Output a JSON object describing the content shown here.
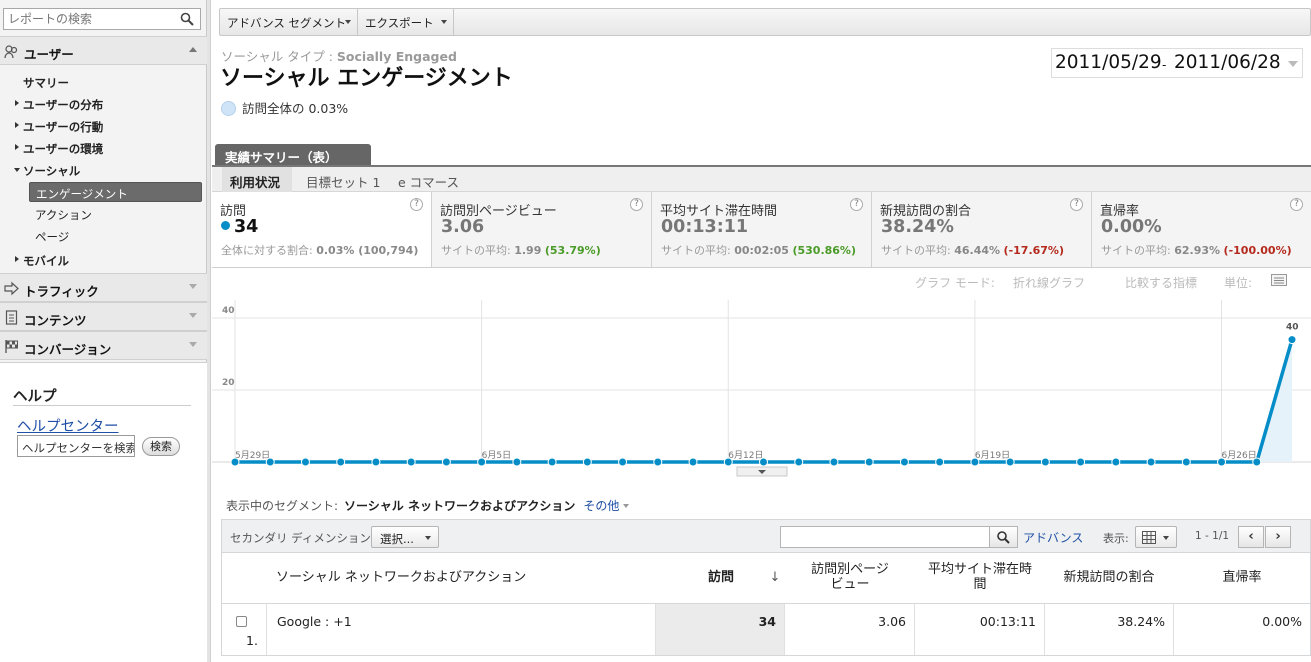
{
  "sidebar": {
    "search_placeholder": "レポートの検索",
    "sections": {
      "users": "ユーザー",
      "traffic": "トラフィック",
      "content": "コンテンツ",
      "conversion": "コンバージョン"
    },
    "items": {
      "summary": "サマリー",
      "distribution": "ユーザーの分布",
      "behavior": "ユーザーの行動",
      "environment": "ユーザーの環境",
      "social": "ソーシャル",
      "engagement": "エンゲージメント",
      "action": "アクション",
      "page": "ページ",
      "mobile": "モバイル"
    },
    "help": {
      "title": "ヘルプ",
      "center_link": "ヘルプセンター",
      "search_input": "ヘルプセンターを検索",
      "search_button": "検索"
    }
  },
  "toolbar": {
    "advanced_segments": "アドバンス セグメント",
    "export": "エクスポート"
  },
  "header": {
    "subtitle_prefix": "ソーシャル タイプ :",
    "subtitle_value": "Socially Engaged",
    "title": "ソーシャル エンゲージメント",
    "percent_text": "訪問全体の 0.03%",
    "date_start": "2011/05/29",
    "date_sep": "-",
    "date_end": "2011/06/28"
  },
  "tabs": {
    "view": "実績サマリー（表）",
    "usage": "利用状況",
    "goal": "目標セット 1",
    "ecommerce": "e コマース"
  },
  "metrics": [
    {
      "name": "訪問",
      "value": "34",
      "avg_label": "全体に対する割合:",
      "avg_value": "0.03% (100,794)",
      "delta": ""
    },
    {
      "name": "訪問別ページビュー",
      "value": "3.06",
      "avg_label": "サイトの平均:",
      "avg_value": "1.99",
      "delta": "(53.79%)"
    },
    {
      "name": "平均サイト滞在時間",
      "value": "00:13:11",
      "avg_label": "サイトの平均:",
      "avg_value": "00:02:05",
      "delta": "(530.86%)"
    },
    {
      "name": "新規訪問の割合",
      "value": "38.24%",
      "avg_label": "サイトの平均:",
      "avg_value": "46.44%",
      "delta": "(-17.67%)"
    },
    {
      "name": "直帰率",
      "value": "0.00%",
      "avg_label": "サイトの平均:",
      "avg_value": "62.93%",
      "delta": "(-100.00%)"
    }
  ],
  "graph_options": {
    "mode_label": "グラフ モード:",
    "mode_value": "折れ線グラフ",
    "compare": "比較する指標",
    "unit": "単位:"
  },
  "chart_data": {
    "type": "line",
    "x": [
      "5月29日",
      "5月30日",
      "5月31日",
      "6月1日",
      "6月2日",
      "6月3日",
      "6月4日",
      "6月5日",
      "6月6日",
      "6月7日",
      "6月8日",
      "6月9日",
      "6月10日",
      "6月11日",
      "6月12日",
      "6月13日",
      "6月14日",
      "6月15日",
      "6月16日",
      "6月17日",
      "6月18日",
      "6月19日",
      "6月20日",
      "6月21日",
      "6月22日",
      "6月23日",
      "6月24日",
      "6月25日",
      "6月26日",
      "6月27日",
      "6月28日"
    ],
    "x_tick_labels": [
      "5月29日",
      "6月5日",
      "6月12日",
      "6月19日",
      "6月26日"
    ],
    "series": [
      {
        "values": [
          0,
          0,
          0,
          0,
          0,
          0,
          0,
          0,
          0,
          0,
          0,
          0,
          0,
          0,
          0,
          0,
          0,
          0,
          0,
          0,
          0,
          0,
          0,
          0,
          0,
          0,
          0,
          0,
          0,
          0,
          34
        ]
      }
    ],
    "y_ticks": [
      "40",
      "20"
    ],
    "ylim": [
      0,
      40
    ],
    "end_label": "40",
    "grid": true,
    "line_color": "#058dc7"
  },
  "segment": {
    "label": "表示中のセグメント:",
    "value": "ソーシャル ネットワークおよびアクション",
    "other": "その他"
  },
  "table_tools": {
    "secondary_label": "セカンダリ ディメンション:",
    "select_label": "選択...",
    "advanced": "アドバンス",
    "show_label": "表示:",
    "pager": "1 - 1/1",
    "prev": "‹",
    "next": "›"
  },
  "table": {
    "headers": {
      "dimension": "ソーシャル ネットワークおよびアクション",
      "visits": "訪問",
      "sort_icon": "↓",
      "pageviews_1": "訪問別ページ",
      "pageviews_2": "ビュー",
      "duration_1": "平均サイト滞在時",
      "duration_2": "間",
      "new_visits": "新規訪問の割合",
      "bounce": "直帰率"
    },
    "rows": [
      {
        "index": "1.",
        "dimension": "Google : +1",
        "visits": "34",
        "pageviews": "3.06",
        "duration": "00:13:11",
        "new_visits": "38.24%",
        "bounce": "0.00%"
      }
    ]
  }
}
